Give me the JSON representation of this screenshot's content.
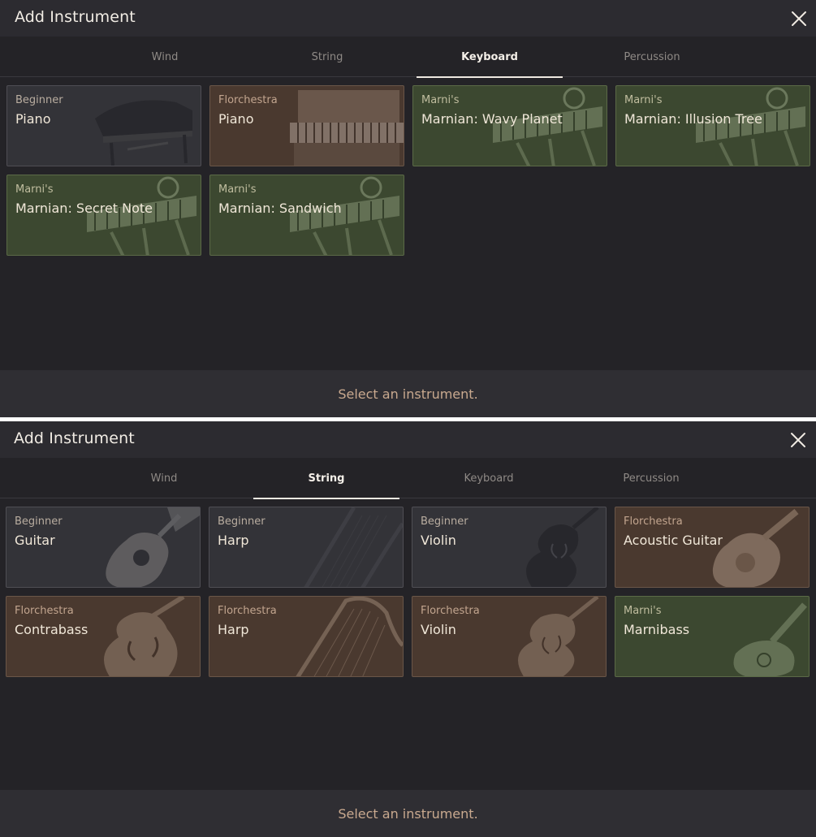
{
  "colors": {
    "background": "#242327",
    "titlebar": "#2c2b30",
    "beginner_card": "#333338",
    "florchestra_card": "#4a392f",
    "marni_card": "#3c4830",
    "footer_text": "#c9a98f"
  },
  "panels": [
    {
      "title": "Add Instrument",
      "close_icon": "close-icon",
      "tabs": [
        {
          "label": "Wind",
          "active": false
        },
        {
          "label": "String",
          "active": false
        },
        {
          "label": "Keyboard",
          "active": true
        },
        {
          "label": "Percussion",
          "active": false
        }
      ],
      "cards": [
        {
          "category": "Beginner",
          "name": "Piano",
          "style": "beginner",
          "icon": "grand-piano-icon"
        },
        {
          "category": "Florchestra",
          "name": "Piano",
          "style": "florchestra",
          "icon": "upright-piano-icon"
        },
        {
          "category": "Marni's",
          "name": "Marnian: Wavy Planet",
          "style": "marni",
          "icon": "marnian-keyboard-icon"
        },
        {
          "category": "Marni's",
          "name": "Marnian: Illusion Tree",
          "style": "marni",
          "icon": "marnian-keyboard-icon"
        },
        {
          "category": "Marni's",
          "name": "Marnian: Secret Note",
          "style": "marni",
          "icon": "marnian-keyboard-icon"
        },
        {
          "category": "Marni's",
          "name": "Marnian: Sandwich",
          "style": "marni",
          "icon": "marnian-keyboard-icon"
        }
      ],
      "footer": "Select an instrument."
    },
    {
      "title": "Add Instrument",
      "close_icon": "close-icon",
      "tabs": [
        {
          "label": "Wind",
          "active": false
        },
        {
          "label": "String",
          "active": true
        },
        {
          "label": "Keyboard",
          "active": false
        },
        {
          "label": "Percussion",
          "active": false
        }
      ],
      "cards": [
        {
          "category": "Beginner",
          "name": "Guitar",
          "style": "beginner",
          "icon": "acoustic-guitar-icon"
        },
        {
          "category": "Beginner",
          "name": "Harp",
          "style": "beginner",
          "icon": "harp-icon"
        },
        {
          "category": "Beginner",
          "name": "Violin",
          "style": "beginner",
          "icon": "violin-icon"
        },
        {
          "category": "Florchestra",
          "name": "Acoustic Guitar",
          "style": "florchestra",
          "icon": "acoustic-guitar-icon"
        },
        {
          "category": "Florchestra",
          "name": "Contrabass",
          "style": "florchestra",
          "icon": "contrabass-icon"
        },
        {
          "category": "Florchestra",
          "name": "Harp",
          "style": "florchestra",
          "icon": "harp-icon"
        },
        {
          "category": "Florchestra",
          "name": "Violin",
          "style": "florchestra",
          "icon": "violin-icon"
        },
        {
          "category": "Marni's",
          "name": "Marnibass",
          "style": "marni",
          "icon": "bass-guitar-icon"
        }
      ],
      "footer": "Select an instrument."
    }
  ]
}
